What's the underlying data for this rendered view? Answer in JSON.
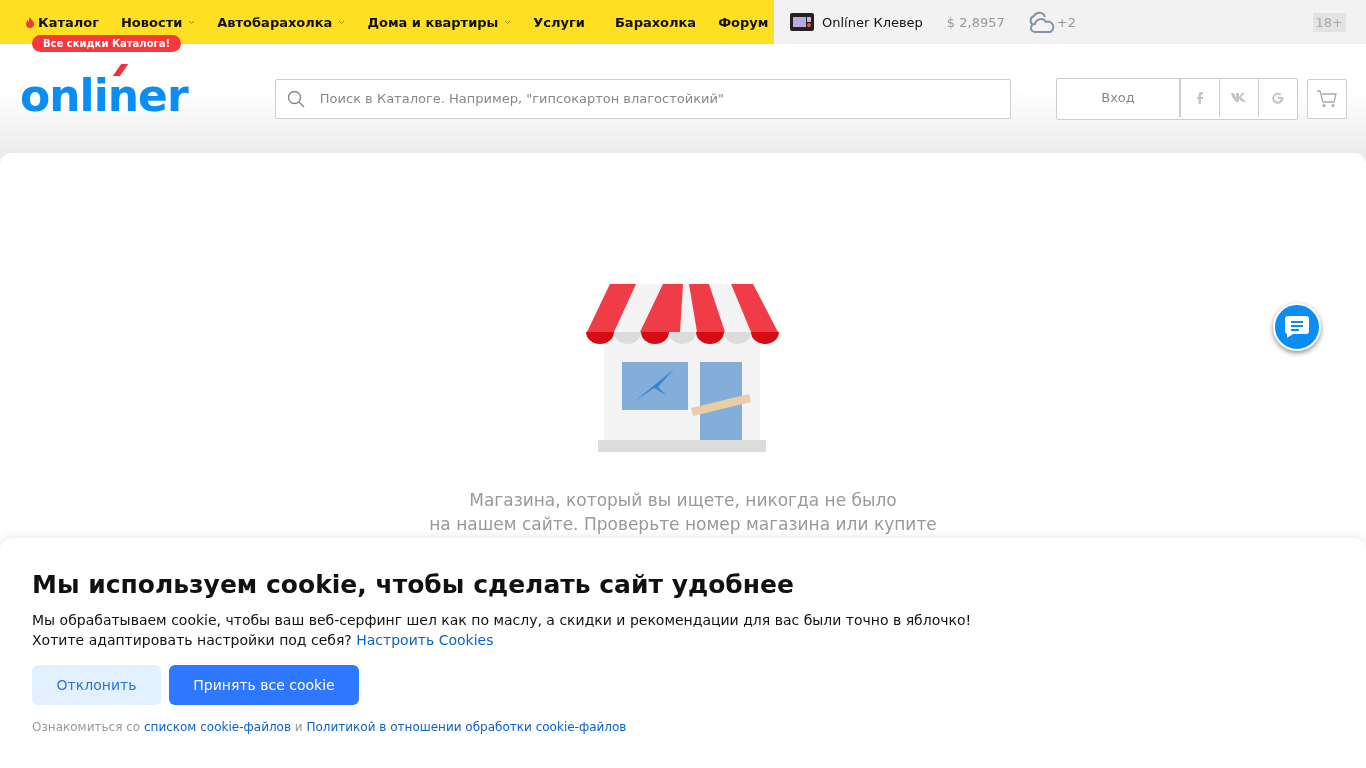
{
  "top_nav": {
    "items": [
      {
        "label": "Каталог",
        "has_dropdown": false,
        "hot": true
      },
      {
        "label": "Новости",
        "has_dropdown": true,
        "hot": false
      },
      {
        "label": "Автобарахолка",
        "has_dropdown": true,
        "hot": false
      },
      {
        "label": "Дома и квартиры",
        "has_dropdown": true,
        "hot": false
      },
      {
        "label": "Услуги",
        "has_dropdown": false,
        "hot": false
      },
      {
        "label": "Барахолка",
        "has_dropdown": false,
        "hot": false
      },
      {
        "label": "Форум",
        "has_dropdown": false,
        "hot": false
      }
    ],
    "promo_badge": "Все скидки Каталога!",
    "clever": "Onlíner Клевер",
    "currency": "$ 2,8957",
    "temperature": "+2",
    "age_rating": "18+"
  },
  "header": {
    "logo": "onliner",
    "search": {
      "placeholder": "Поиск в Каталоге. Например, \"гипсокартон влагостойкий\""
    },
    "login": "Вход"
  },
  "message": [
    "Магазина, который вы ищете, никогда не было",
    "на нашем сайте. Проверьте номер магазина или купите"
  ],
  "cookie_banner": {
    "title": "Мы используем cookie, чтобы сделать сайт удобнее",
    "text": "Мы обрабатываем cookie, чтобы ваш веб-серфинг шел как по маслу, а скидки и рекомендации для вас были точно в яблочко!",
    "question": "Хотите адаптировать настройки под себя?",
    "settings_link": "Настроить Cookies",
    "decline": "Отклонить",
    "accept": "Принять все cookie",
    "footer_prefix": "Ознакомиться со",
    "footer_link_1": "списком cookie-файлов",
    "footer_and": "и",
    "footer_link_2": "Политикой в отношении обработки cookie-файлов"
  }
}
